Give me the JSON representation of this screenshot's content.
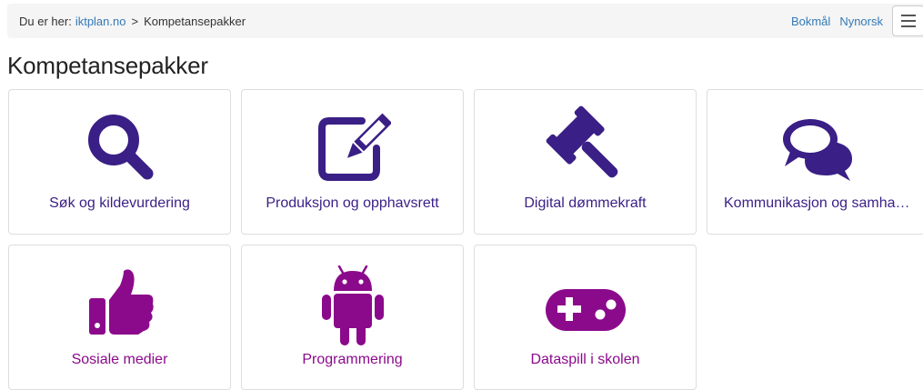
{
  "breadcrumb": {
    "prefix": "Du er her:",
    "home": "iktplan.no",
    "separator": ">",
    "current": "Kompetansepakker"
  },
  "languages": [
    "Bokmål",
    "Nynorsk"
  ],
  "menu_icon": "hamburger-icon",
  "page_title": "Kompetansepakker",
  "colors": {
    "indigo": "#3a1f86",
    "purple": "#8b0a8b",
    "link": "#337ab7",
    "topbar_bg": "#f5f5f5"
  },
  "tiles": [
    {
      "label": "Søk og kildevurdering",
      "icon": "search-icon"
    },
    {
      "label": "Produksjon og opphavsrett",
      "icon": "edit-icon"
    },
    {
      "label": "Digital dømmekraft",
      "icon": "gavel-icon"
    },
    {
      "label": "Kommunikasjon og samhandling",
      "icon": "comments-icon"
    },
    {
      "label": "Sosiale medier",
      "icon": "thumbs-up-icon"
    },
    {
      "label": "Programmering",
      "icon": "android-icon"
    },
    {
      "label": "Dataspill i skolen",
      "icon": "gamepad-icon"
    }
  ]
}
